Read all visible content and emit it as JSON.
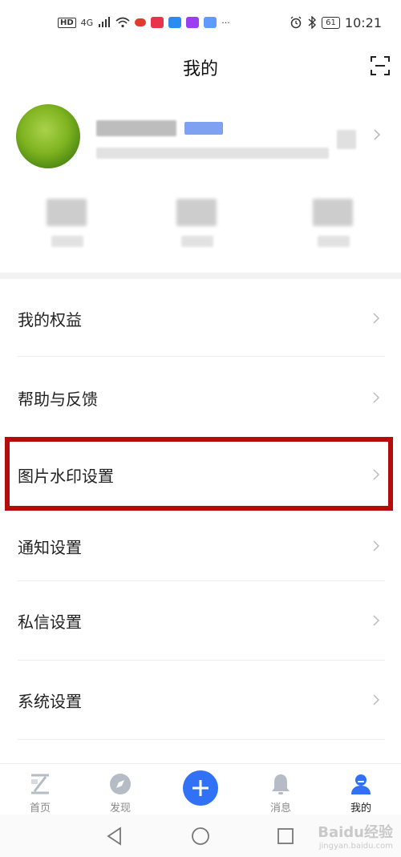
{
  "status_bar": {
    "hd": "HD",
    "signal": "4G",
    "more": "···",
    "battery": "61",
    "time": "10:21"
  },
  "header": {
    "title": "我的",
    "scan_icon": "scan-icon"
  },
  "profile": {
    "avatar_icon": "avatar",
    "chevron_icon": "chevron-right-icon"
  },
  "menu": {
    "items": [
      {
        "label": "我的权益"
      },
      {
        "label": "帮助与反馈"
      },
      {
        "label": "图片水印设置"
      },
      {
        "label": "通知设置"
      },
      {
        "label": "私信设置"
      },
      {
        "label": "系统设置"
      }
    ],
    "highlight_color": "#b40c0c"
  },
  "bottom_nav": {
    "items": [
      {
        "label": "首页",
        "icon": "home-icon"
      },
      {
        "label": "发现",
        "icon": "compass-icon"
      },
      {
        "label": "",
        "icon": "plus-icon"
      },
      {
        "label": "消息",
        "icon": "bell-icon"
      },
      {
        "label": "我的",
        "icon": "user-icon"
      }
    ],
    "accent": "#3171f6"
  },
  "watermark": {
    "line1": "Baidu经验",
    "line2": "jingyan.baidu.com"
  }
}
